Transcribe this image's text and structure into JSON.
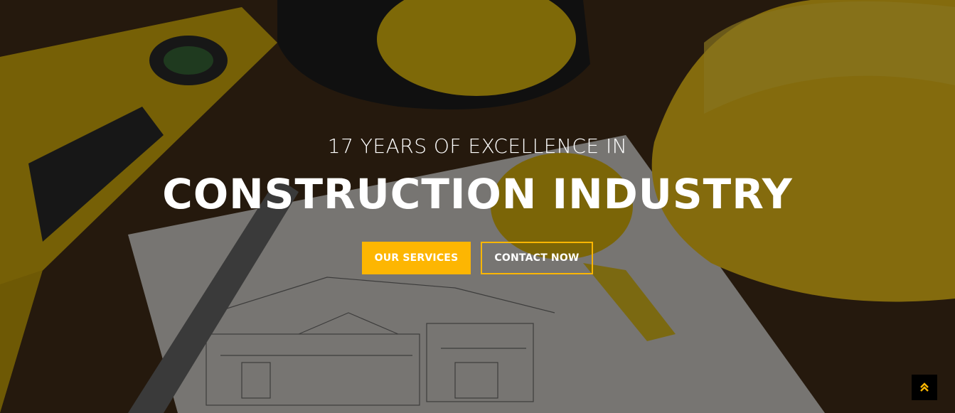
{
  "hero": {
    "subtitle": "17 YEARS OF EXCELLENCE IN",
    "title": "CONSTRUCTION INDUSTRY",
    "primary_button": "OUR SERVICES",
    "secondary_button": "CONTACT NOW"
  },
  "scroll_top": {
    "icon": "double-chevron-up-icon"
  },
  "colors": {
    "accent": "#fdb602",
    "text": "#ffffff",
    "scroll_bg": "#000000"
  }
}
